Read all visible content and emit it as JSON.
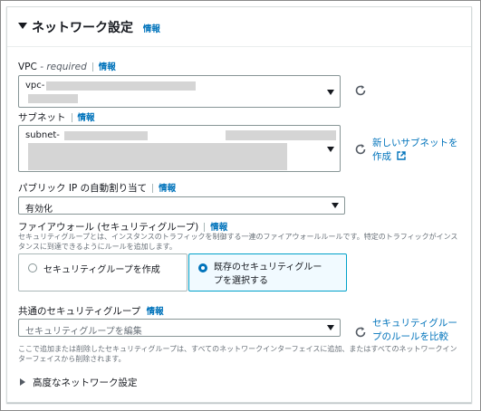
{
  "header": {
    "title": "ネットワーク設定",
    "info": "情報"
  },
  "vpc": {
    "label": "VPC",
    "required": "- required",
    "info": "情報",
    "value_prefix": "vpc-"
  },
  "subnet": {
    "label": "サブネット",
    "info": "情報",
    "value_prefix": "subnet-",
    "new_link": "新しいサブネットを作成"
  },
  "public_ip": {
    "label": "パブリック IP の自動割り当て",
    "info": "情報",
    "value": "有効化"
  },
  "firewall": {
    "label": "ファイアウォール (セキュリティグループ)",
    "info": "情報",
    "description": "セキュリティグループとは、インスタンスのトラフィックを制御する一連のファイアウォールルールです。特定のトラフィックがインスタンスに到達できるようにルールを追加します。",
    "option_create": "セキュリティグループを作成",
    "option_existing": "既存のセキュリティグループを選択する",
    "selected": "existing"
  },
  "common_sg": {
    "label": "共通のセキュリティグループ",
    "info": "情報",
    "placeholder": "セキュリティグループを編集",
    "compare_link": "セキュリティグループのルールを比較",
    "description": "ここで追加または削除したセキュリティグループは、すべてのネットワークインターフェイスに追加、またはすべてのネットワークインターフェイスから削除されます。"
  },
  "advanced": {
    "label": "高度なネットワーク設定"
  },
  "colors": {
    "link": "#0073bb",
    "selected_border": "#00a1c9",
    "selected_bg": "#f1faff"
  },
  "icons": {
    "refresh": "refresh-icon",
    "external": "external-link-icon",
    "caret": "caret-down-icon",
    "expand": "caret-right-icon"
  }
}
